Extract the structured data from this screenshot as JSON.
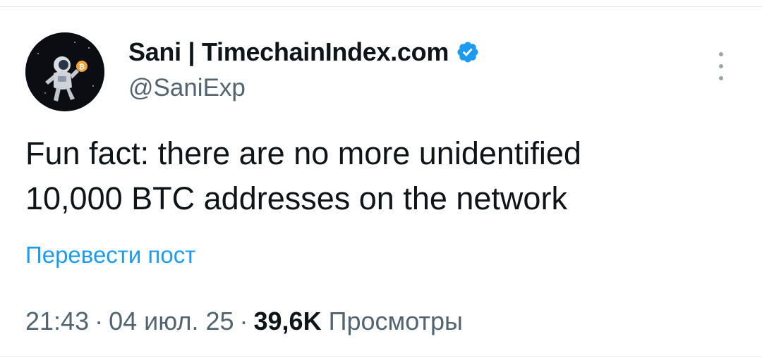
{
  "author": {
    "display_name": "Sani | TimechainIndex.com",
    "handle": "@SaniExp",
    "verified_icon": "verified-badge-icon",
    "avatar_icon": "astronaut-bitcoin-avatar"
  },
  "menu": {
    "icon": "more-options-icon"
  },
  "tweet": {
    "lines": [
      "Fun fact: there are no more unidentified",
      "10,000 BTC addresses on the network"
    ]
  },
  "translate_label": "Перевести пост",
  "meta": {
    "time": "21:43",
    "separator": "·",
    "date": "04 июл. 25",
    "views_count": "39,6K",
    "views_label": "Просмотры"
  },
  "colors": {
    "text": "#0f1419",
    "secondary": "#536471",
    "accent": "#1d9bf0"
  }
}
